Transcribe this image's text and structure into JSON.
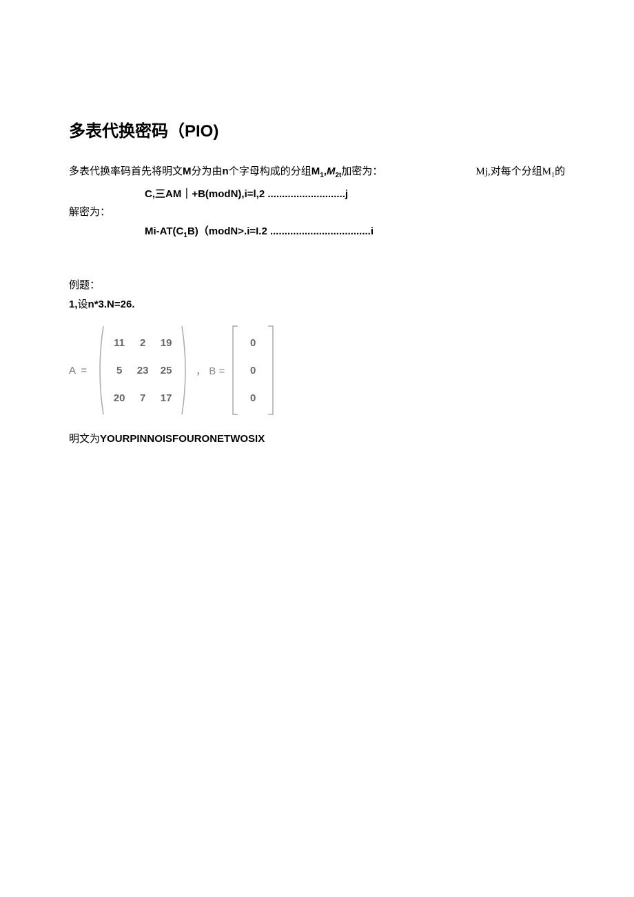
{
  "title": "多表代换密码（PIO)",
  "intro": {
    "left": "多表代换率码首先将明文",
    "bold1": "M",
    "mid1": "分为由",
    "bold2": "n",
    "mid2": "个字母构成的分组",
    "bold3": "M",
    "sub1": "1",
    "comma": ",",
    "bold4": "M",
    "sub2": "2t",
    "mid3": "加密为：",
    "right_bold": "Mj,",
    "right_text1": "对每个分组",
    "right_bold2": "M",
    "right_sub": "1",
    "right_text2": "的"
  },
  "formula_enc": "C,三AM｜+B(modN),i=l,2 ...........................j",
  "label_dec": "解密为：",
  "formula_dec_pre": "Mi-AT(C",
  "formula_dec_sub": "1",
  "formula_dec_post": "B)（modN>.i=I.2 ...................................i",
  "example_label": "例题：",
  "example_params_pre": "1,",
  "example_params_mid": "设",
  "example_params_post": "n*3.N=26.",
  "matrix": {
    "A_label": "A =",
    "A": [
      [
        "11",
        "2",
        "19"
      ],
      [
        "5",
        "23",
        "25"
      ],
      [
        "20",
        "7",
        "17"
      ]
    ],
    "sep": "， B =",
    "B": [
      [
        "0"
      ],
      [
        "0"
      ],
      [
        "0"
      ]
    ]
  },
  "plaintext_label": "明文为",
  "plaintext_value": "YOURPINNOISFOURONETWOSIX"
}
